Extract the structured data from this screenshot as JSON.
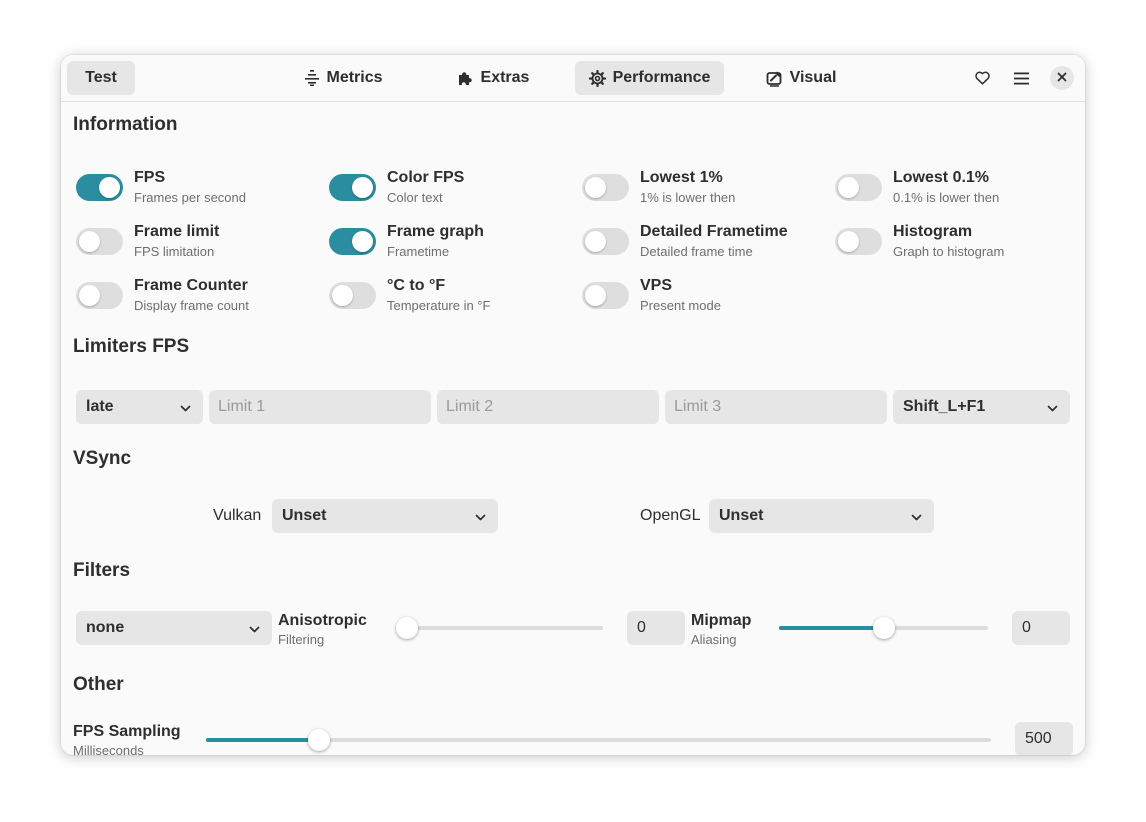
{
  "header": {
    "test_label": "Test",
    "tabs": [
      {
        "label": "Metrics",
        "icon": "metrics-icon",
        "active": false
      },
      {
        "label": "Extras",
        "icon": "puzzle-icon",
        "active": false
      },
      {
        "label": "Performance",
        "icon": "gear-icon",
        "active": true
      },
      {
        "label": "Visual",
        "icon": "visual-icon",
        "active": false
      }
    ]
  },
  "information": {
    "title": "Information",
    "options": [
      {
        "label": "FPS",
        "sub": "Frames per second",
        "on": true
      },
      {
        "label": "Color FPS",
        "sub": "Color text",
        "on": true
      },
      {
        "label": "Lowest 1%",
        "sub": "1% is lower then",
        "on": false
      },
      {
        "label": "Lowest 0.1%",
        "sub": "0.1% is lower then",
        "on": false
      },
      {
        "label": "Frame limit",
        "sub": "FPS limitation",
        "on": false
      },
      {
        "label": "Frame graph",
        "sub": "Frametime",
        "on": true
      },
      {
        "label": "Detailed Frametime",
        "sub": "Detailed frame time",
        "on": false
      },
      {
        "label": "Histogram",
        "sub": "Graph to histogram",
        "on": false
      },
      {
        "label": "Frame Counter",
        "sub": "Display frame count",
        "on": false
      },
      {
        "label": "°C to °F",
        "sub": "Temperature in °F",
        "on": false
      },
      {
        "label": "VPS",
        "sub": "Present mode",
        "on": false
      }
    ]
  },
  "limiters": {
    "title": "Limiters FPS",
    "method": "late",
    "limit1_placeholder": "Limit 1",
    "limit2_placeholder": "Limit 2",
    "limit3_placeholder": "Limit 3",
    "toggle_key": "Shift_L+F1"
  },
  "vsync": {
    "title": "VSync",
    "vulkan_label": "Vulkan",
    "vulkan_value": "Unset",
    "opengl_label": "OpenGL",
    "opengl_value": "Unset"
  },
  "filters": {
    "title": "Filters",
    "filter_value": "none",
    "anisotropic_label": "Anisotropic",
    "anisotropic_sub": "Filtering",
    "anisotropic_value": "0",
    "anisotropic_fraction": 0.0,
    "mipmap_label": "Mipmap",
    "mipmap_sub": "Aliasing",
    "mipmap_value": "0",
    "mipmap_fraction": 0.5
  },
  "other": {
    "title": "Other",
    "fps_sampling_label": "FPS Sampling",
    "fps_sampling_sub": "Milliseconds",
    "fps_sampling_value": "500",
    "fps_sampling_fraction": 0.144
  },
  "colors": {
    "accent": "#2a8ea0",
    "switch_off": "#dedede",
    "control_bg": "#e6e6e6"
  }
}
